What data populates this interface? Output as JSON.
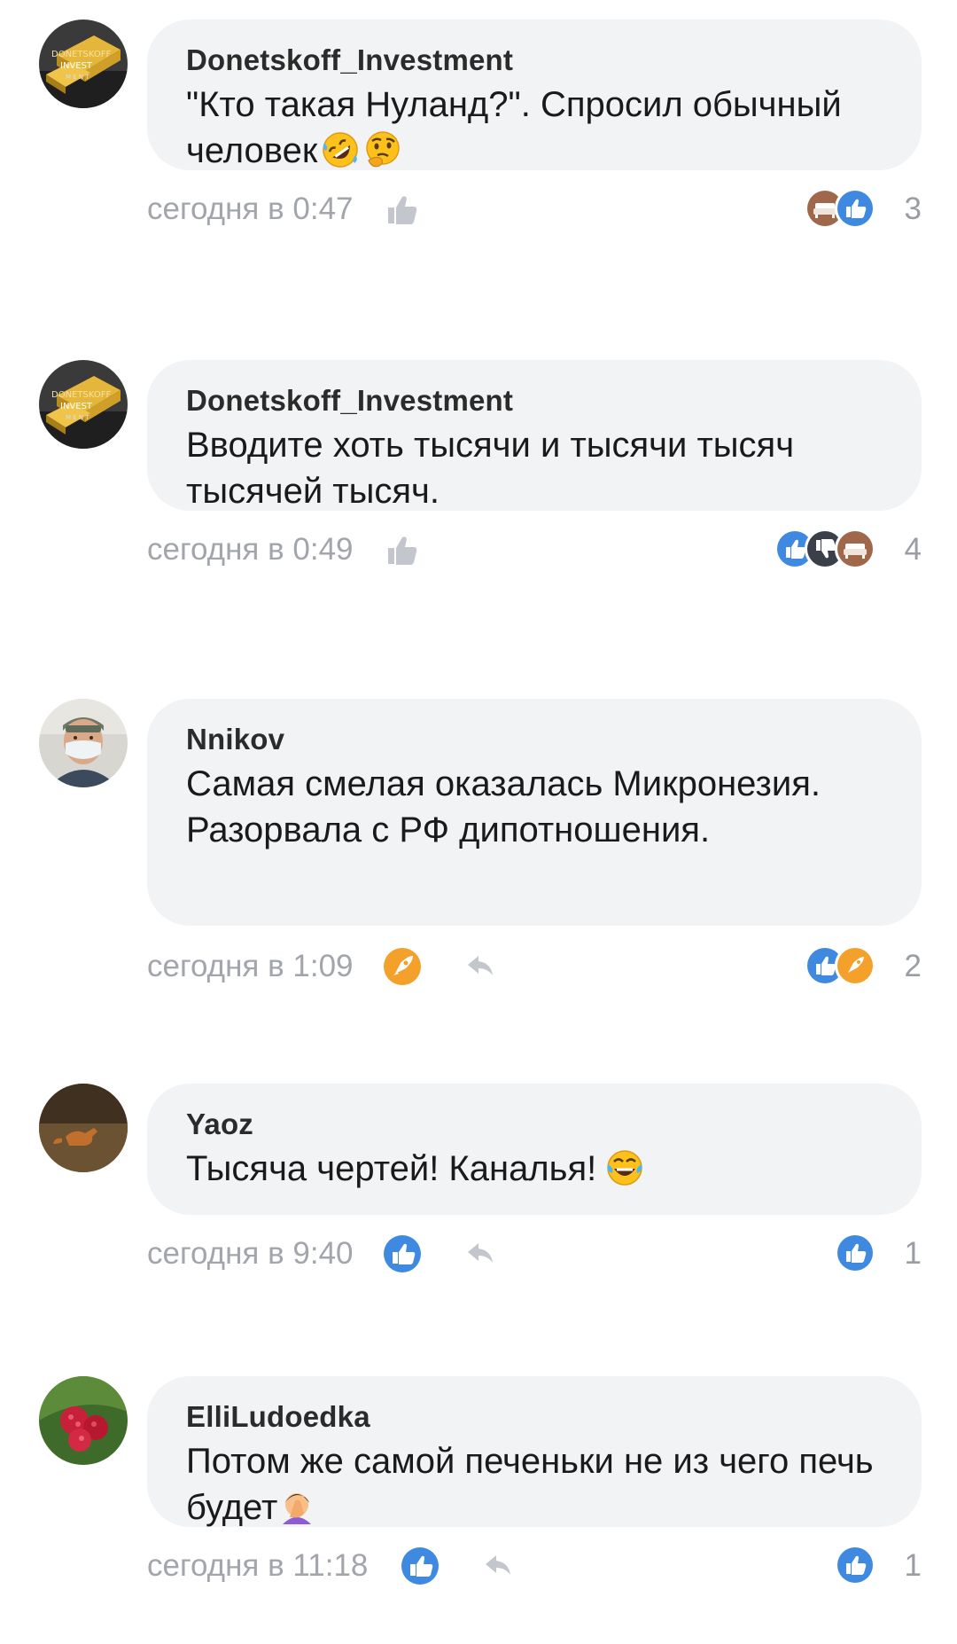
{
  "comments": [
    {
      "author": "Donetskoff_Investment",
      "avatar": "gold-bars-avatar",
      "text": "\"Кто такая Нуланд?\". Спросил обычный человек",
      "text_emoji": [
        "rofl-emoji",
        "thinking-emoji"
      ],
      "time": "сегодня в 0:47",
      "my_reaction": "like-outline-icon",
      "show_reply": false,
      "reactions": [
        "sofa-reaction",
        "like-reaction"
      ],
      "reaction_count": "3"
    },
    {
      "author": "Donetskoff_Investment",
      "avatar": "gold-bars-avatar",
      "text": "Вводите хоть тысячи и тысячи тысяч тысячей тысяч.",
      "text_emoji": [],
      "time": "сегодня в 0:49",
      "my_reaction": "like-outline-icon",
      "show_reply": false,
      "reactions": [
        "like-reaction",
        "dislike-reaction",
        "sofa-reaction"
      ],
      "reaction_count": "4"
    },
    {
      "author": "Nnikov",
      "avatar": "masked-man-avatar",
      "text": "Самая смелая оказалась Микронезия. Разорвала с РФ дипотношения.",
      "text_emoji": [],
      "time": "сегодня в 1:09",
      "my_reaction": "rocket-reaction",
      "show_reply": true,
      "reactions": [
        "like-reaction",
        "rocket-reaction"
      ],
      "reaction_count": "2"
    },
    {
      "author": "Yaoz",
      "avatar": "fox-avatar",
      "text": "Тысяча чертей! Каналья!",
      "text_emoji": [
        "laughing-tears-emoji"
      ],
      "time": "сегодня в 9:40",
      "my_reaction": "like-reaction",
      "show_reply": true,
      "reactions": [
        "like-reaction"
      ],
      "reaction_count": "1"
    },
    {
      "author": "ElliLudoedka",
      "avatar": "raspberry-avatar",
      "text": "Потом же самой печеньки не из чего печь будет",
      "text_emoji": [
        "facepalm-emoji"
      ],
      "time": "сегодня в 11:18",
      "my_reaction": "like-reaction",
      "show_reply": true,
      "reactions": [
        "like-reaction"
      ],
      "reaction_count": "1"
    }
  ],
  "colors": {
    "bubble": "#f2f3f5",
    "meta_text": "#a2a5ab",
    "like_blue": "#3f8ae0",
    "dislike_dark": "#3a3f4a",
    "sofa_brown": "#a0684a",
    "rocket_orange": "#f4a12b"
  }
}
